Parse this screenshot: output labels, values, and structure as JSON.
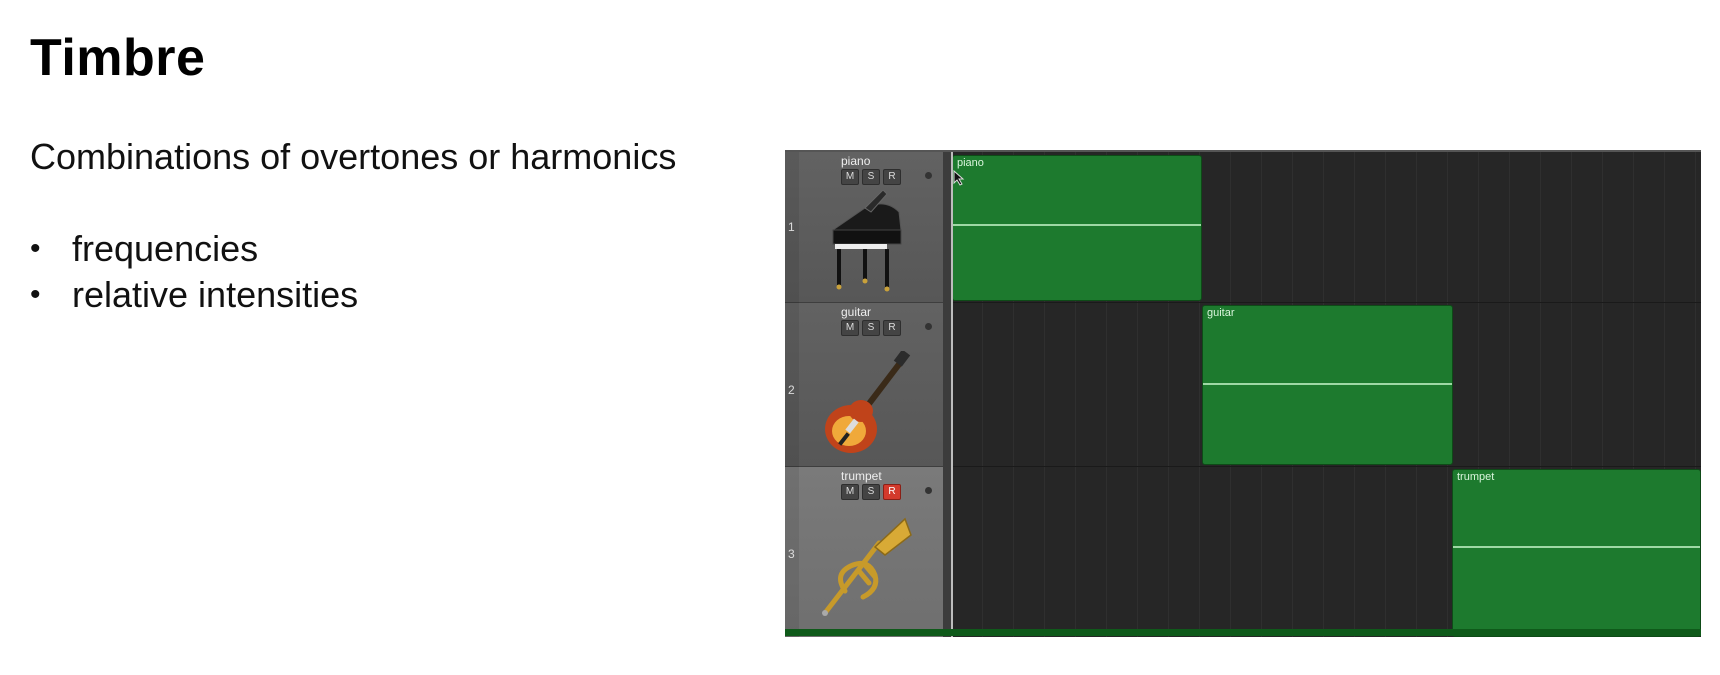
{
  "slide": {
    "title": "Timbre",
    "subtitle": "Combinations of overtones or harmonics",
    "bullets": [
      "frequencies",
      "relative intensities"
    ]
  },
  "daw": {
    "tracks": [
      {
        "number": "1",
        "name": "piano",
        "buttons": [
          "M",
          "S",
          "R"
        ],
        "record_armed": false,
        "selected": false,
        "icon": "piano-icon",
        "region_label": "piano"
      },
      {
        "number": "2",
        "name": "guitar",
        "buttons": [
          "M",
          "S",
          "R"
        ],
        "record_armed": false,
        "selected": false,
        "icon": "guitar-icon",
        "region_label": "guitar"
      },
      {
        "number": "3",
        "name": "trumpet",
        "buttons": [
          "M",
          "S",
          "R"
        ],
        "record_armed": true,
        "selected": true,
        "icon": "trumpet-icon",
        "region_label": "trumpet"
      }
    ],
    "colors": {
      "region": "#1d7a2e",
      "record": "#d33a2c",
      "background": "#262626"
    }
  }
}
